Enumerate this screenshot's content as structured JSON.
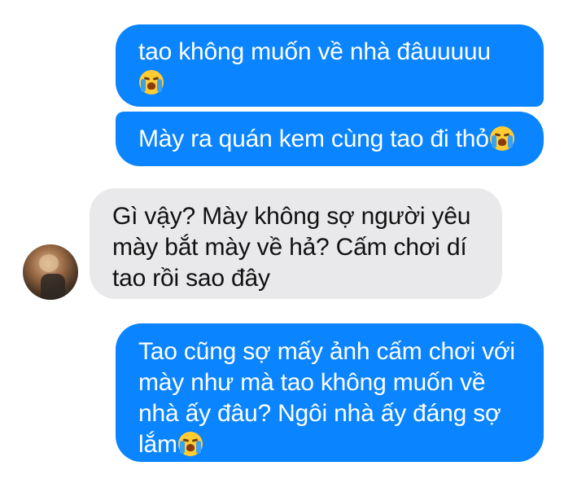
{
  "messages": [
    {
      "id": "m1",
      "sender": "me",
      "lines": [
        "tao không muốn về nhà đâuuuuu",
        ""
      ],
      "emoji": "crying-face"
    },
    {
      "id": "m2",
      "sender": "me",
      "lines": [
        "Mày ra quán kem cùng tao đi thỏ"
      ],
      "emoji": "crying-face"
    },
    {
      "id": "m3",
      "sender": "friend",
      "lines": [
        "Gì vậy? Mày không sợ người yêu",
        "mày bắt mày về hả? Cấm chơi dí",
        "tao rồi sao đây"
      ],
      "emoji": null
    },
    {
      "id": "m4",
      "sender": "me",
      "lines": [
        "Tao cũng sợ mấy ảnh cấm chơi với",
        "mày như mà tao không muốn về",
        "nhà ấy đâu? Ngôi nhà ấy đáng sợ",
        "lắm"
      ],
      "emoji": "crying-face"
    }
  ],
  "colors": {
    "outgoing_bubble": "#0a84ff",
    "incoming_bubble": "#e9e9eb",
    "background": "#ffffff"
  },
  "icons": {
    "crying_emoji": "loudly-crying-face-emoji",
    "avatar": "contact-avatar"
  }
}
